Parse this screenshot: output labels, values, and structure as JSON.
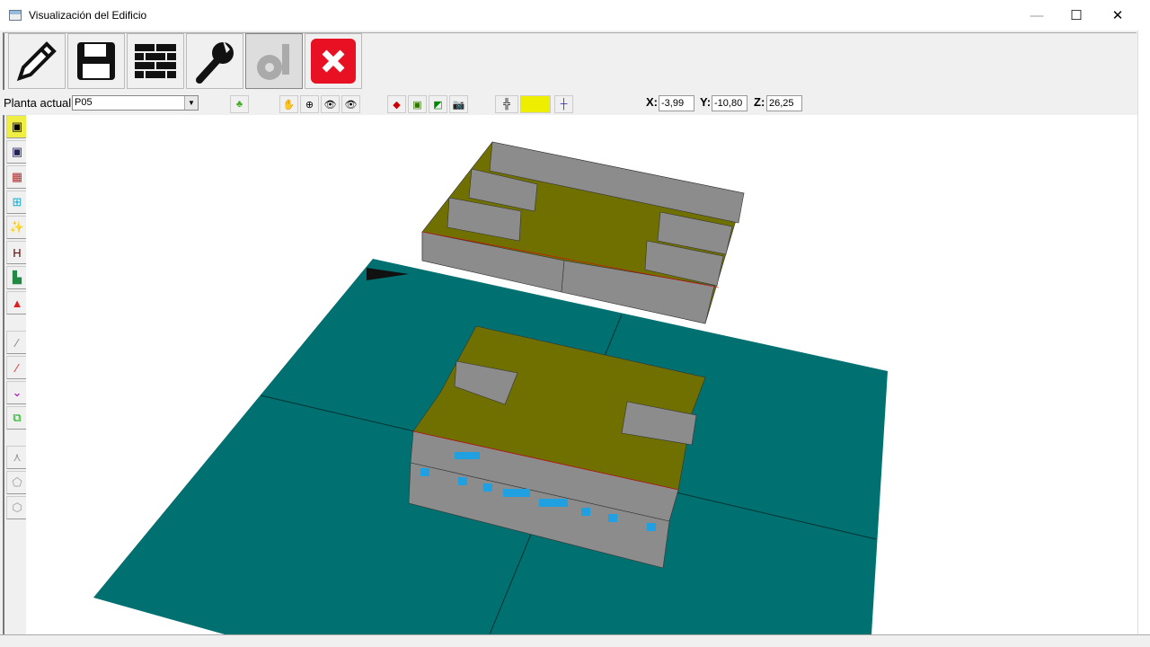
{
  "window": {
    "title": "Visualización del Edificio",
    "minimize": "—",
    "maximize": "☐",
    "close": "✕"
  },
  "toolbar": {
    "buttons": [
      {
        "name": "edit",
        "icon": "pencil-icon"
      },
      {
        "name": "save",
        "icon": "floppy-icon"
      },
      {
        "name": "walls",
        "icon": "brick-icon"
      },
      {
        "name": "settings",
        "icon": "wrench-icon"
      },
      {
        "name": "tools",
        "icon": "tools-icon",
        "pressed": true
      },
      {
        "name": "close",
        "icon": "close-icon",
        "color": "#e81123"
      }
    ]
  },
  "floorbar": {
    "label": "Planta actual",
    "floor": "P05"
  },
  "coords": {
    "x_label": "X:",
    "x": "-3,99",
    "y_label": "Y:",
    "y": "-10,80",
    "z_label": "Z:",
    "z": "26,25"
  },
  "colors": {
    "ground": "#007070",
    "roof": "#707000",
    "wall": "#8c8c8c",
    "window": "#20a0e0"
  }
}
